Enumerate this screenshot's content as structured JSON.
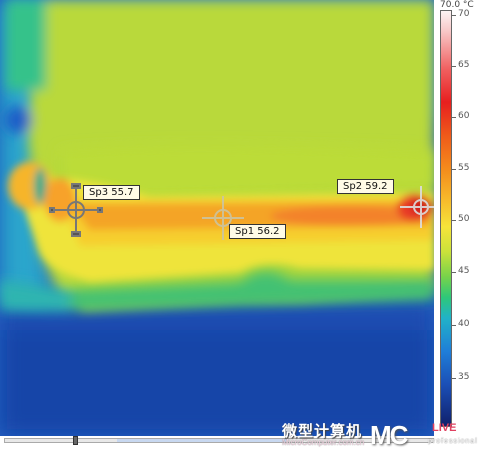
{
  "thermal_image": {
    "spots": [
      {
        "id": "sp3",
        "label": "Sp3 55.7",
        "marker_color": "#777777"
      },
      {
        "id": "sp1",
        "label": "Sp1 56.2",
        "marker_color": "#b9b9a0"
      },
      {
        "id": "sp2",
        "label": "Sp2 59.2",
        "marker_color": "#d8d8d8"
      }
    ]
  },
  "colorbar": {
    "unit_label": "70.0 °C",
    "ticks": [
      "70",
      "65",
      "60",
      "55",
      "50",
      "45",
      "40",
      "35"
    ]
  },
  "watermark": {
    "cn": "微型计算机",
    "en": "MicroComputer.com.cn",
    "brand": "MC",
    "live": "LIVE",
    "pro": "professional"
  },
  "scrollbar": {
    "label": "image-scroll"
  }
}
